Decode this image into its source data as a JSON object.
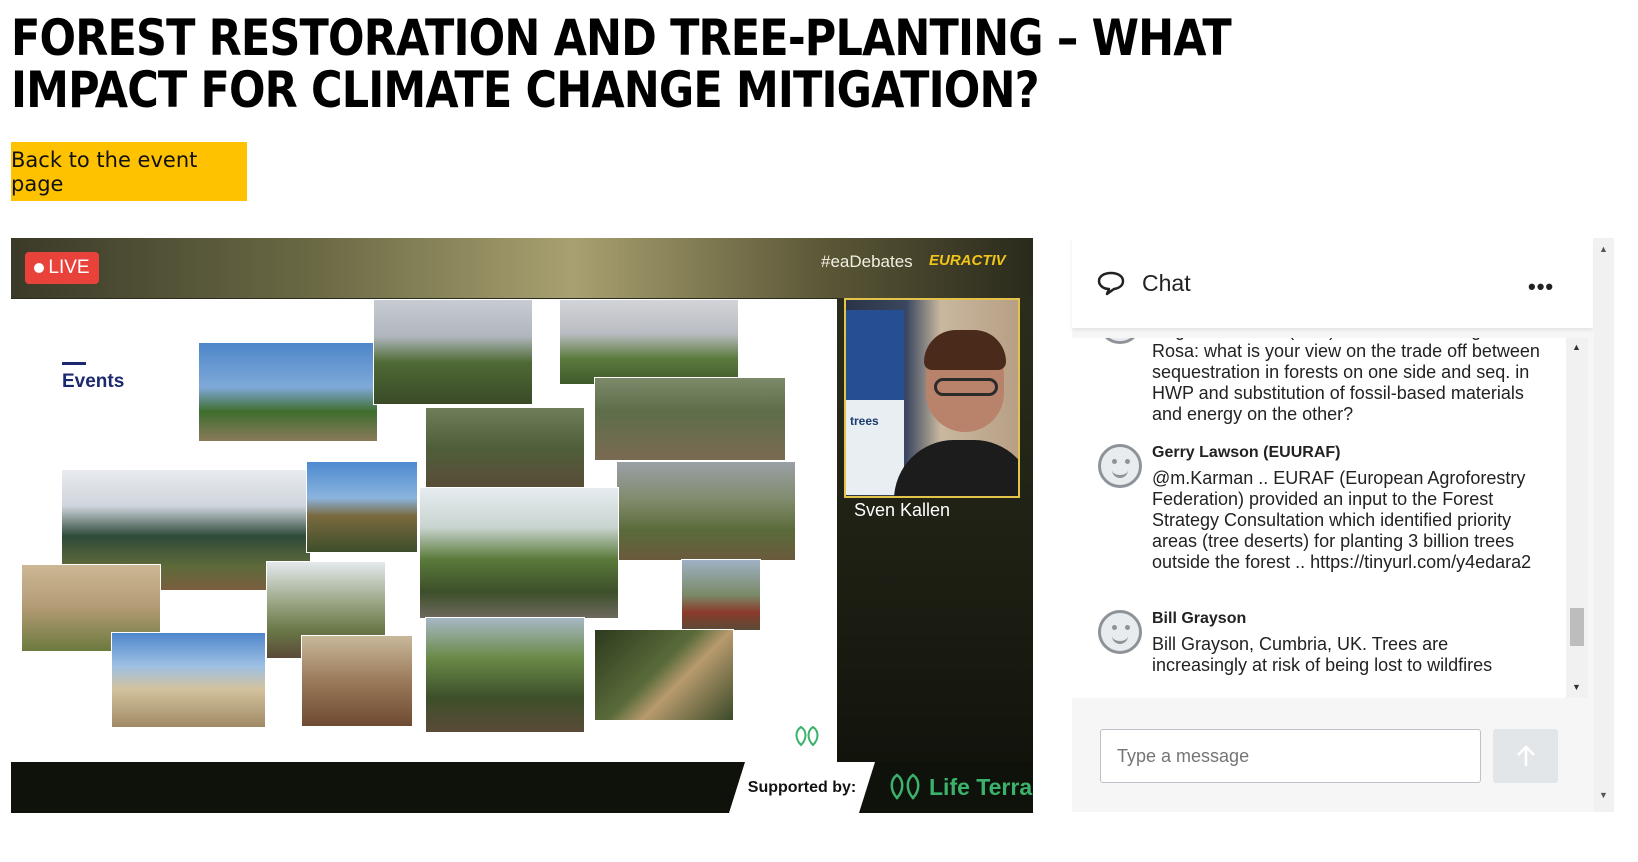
{
  "page": {
    "title": "FOREST RESTORATION AND TREE-PLANTING – WHAT IMPACT FOR CLIMATE CHANGE MITIGATION?",
    "back_button": "Back to the event page"
  },
  "video": {
    "live_label": "LIVE",
    "hashtag": "#eaDebates",
    "brand": "EURACTIV",
    "slide_heading": "Events",
    "speaker_name": "Sven Kallen",
    "speaker_banner_text": "trees",
    "supported_label": "Supported by:",
    "sponsor": "Life Terra",
    "colors": {
      "live": "#e8423b",
      "brand": "#f0c419",
      "sponsor": "#3bb26b",
      "speaker_border": "#e4c34a"
    }
  },
  "chat": {
    "title": "Chat",
    "menu_icon": "more-dots-icon",
    "messages": [
      {
        "author": "",
        "text": "Ragnar Jonsson (SLU) to Humberto Delgado Rosa: what is your view on the trade off between sequestration in forests on one side and seq. in HWP and substitution of fossil-based materials and energy on the other?"
      },
      {
        "author": "Gerry Lawson (EUURAF)",
        "text": "@m.Karman .. EURAF (European Agroforestry Federation) provided an input to the Forest Strategy Consultation which identified priority areas (tree deserts) for planting 3 billion trees outside the forest .. https://tinyurl.com/y4edara2"
      },
      {
        "author": "Bill Grayson",
        "text": "Bill Grayson, Cumbria, UK. Trees are increasingly at risk of being lost to wildfires"
      }
    ],
    "input_placeholder": "Type a message",
    "send_icon": "arrow-up-icon"
  }
}
